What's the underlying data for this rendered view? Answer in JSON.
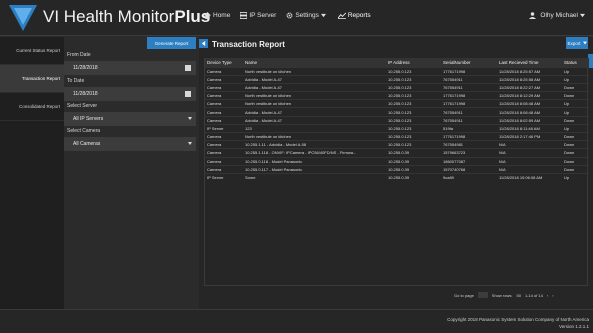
{
  "app": {
    "brand_prefix": "VI",
    "brand_name": "Health Monitor",
    "brand_suffix": "Plus"
  },
  "nav": {
    "home": "Home",
    "ip_server": "IP Server",
    "settings": "Settings",
    "reports": "Reports",
    "user": "Olhy Michael"
  },
  "sidebar": {
    "items": [
      {
        "label": "Current Status Report"
      },
      {
        "label": "Transaction Report"
      },
      {
        "label": "Consolidated Report"
      }
    ]
  },
  "filter": {
    "generate_label": "Generate Report",
    "from_label": "From Date",
    "from_value": "11/28/2018",
    "to_label": "To Date",
    "to_value": "11/28/2018",
    "server_label": "Select Server",
    "server_value": "All IP Servers",
    "camera_label": "Select Camera",
    "camera_value": "All Cameras"
  },
  "report": {
    "title": "Transaction Report",
    "export_label": "Export",
    "columns": [
      "Device Type",
      "Name",
      "IP Address",
      "SerialNumber",
      "Last Recieved Time",
      "Status"
    ],
    "rows": [
      [
        "Camera",
        "North vestibule on kitchen",
        "10.255.0.123",
        "1776171998",
        "11/28/2018 8:25:57 AM",
        "Up"
      ],
      [
        "Camera",
        "Advidia - Model A-47",
        "10.255.0.123",
        "767554911",
        "11/28/2018 8:25:58 AM",
        "Up"
      ],
      [
        "Camera",
        "Advidia - Model A-47",
        "10.255.0.123",
        "767554911",
        "11/28/2018 8:22:27 AM",
        "Down"
      ],
      [
        "Camera",
        "North vestibule on kitchen",
        "10.255.0.123",
        "1776171998",
        "11/28/2018 8:12:29 AM",
        "Down"
      ],
      [
        "Camera",
        "North vestibule on kitchen",
        "10.255.0.123",
        "1776171998",
        "11/28/2018 8:08:48 AM",
        "Up"
      ],
      [
        "Camera",
        "Advidia - Model A-47",
        "10.255.0.123",
        "767554911",
        "11/28/2018 8:08:48 AM",
        "Up"
      ],
      [
        "Camera",
        "Advidia - Model A-47",
        "10.255.0.123",
        "767554911",
        "11/28/2018 8:02:59 AM",
        "Down"
      ],
      [
        "IP Server",
        "123",
        "10.255.0.123",
        "519fa",
        "11/28/2018 8:11:48 AM",
        "Up"
      ],
      [
        "Camera",
        "North vestibule on kitchen",
        "10.255.0.123",
        "1776171998",
        "11/28/2018 2:17:46 PM",
        "Down"
      ],
      [
        "Camera",
        "10.255.1.11 - Advidia - Model A-58",
        "10.255.0.123",
        "767554981",
        "N/A",
        "Down"
      ],
      [
        "Camera",
        "10.255.1.118 - ONVIF: IPCamera - IPC56/40FD/NS - Firmwa...",
        "10.255.0.39",
        "1579663723",
        "N/A",
        "Down"
      ],
      [
        "Camera",
        "10.255.0.118 - Model Panasonic",
        "10.255.0.39",
        "1860077087",
        "N/A",
        "Down"
      ],
      [
        "Camera",
        "10.255.0.117 - Model Panasonic",
        "10.255.0.39",
        "1570740768",
        "N/A",
        "Down"
      ],
      [
        "IP Server",
        "Some",
        "10.255.0.39",
        "9ca89",
        "11/28/2018 10:06:08 AM",
        "Up"
      ]
    ],
    "goto_label": "Go to page",
    "show_rows_label": "Show rows:",
    "rows_per_page": "50",
    "range_label": "1-14 of 14"
  },
  "footer": {
    "copyright": "Copyright 2018 Panasonic System Solution Company of North America",
    "version": "Version 1.2.1.1"
  },
  "colors": {
    "accent": "#2d7fc1",
    "background": "#2b2b2b",
    "panel": "#262626"
  }
}
